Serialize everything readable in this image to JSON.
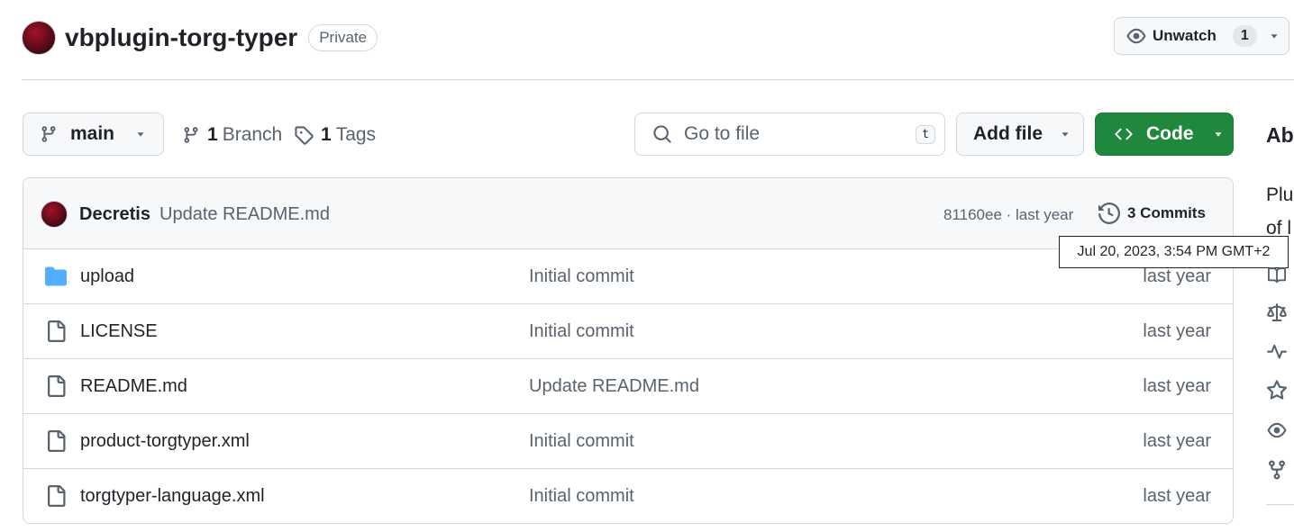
{
  "repo": {
    "name": "vbplugin-torg-typer",
    "visibility": "Private",
    "watch_label": "Unwatch",
    "watch_count": "1"
  },
  "toolbar": {
    "branch": "main",
    "branches_count": "1",
    "branches_label": "Branch",
    "tags_count": "1",
    "tags_label": "Tags",
    "go_to_file_placeholder": "Go to file",
    "go_to_file_shortcut": "t",
    "add_file_label": "Add file",
    "code_label": "Code"
  },
  "latest_commit": {
    "author": "Decretis",
    "message": "Update README.md",
    "hash_and_time": "81160ee · last year",
    "commits_label": "3 Commits"
  },
  "tooltip": "Jul 20, 2023, 3:54 PM GMT+2",
  "files": [
    {
      "type": "folder",
      "name": "upload",
      "commit": "Initial commit",
      "date": "last year"
    },
    {
      "type": "file",
      "name": "LICENSE",
      "commit": "Initial commit",
      "date": "last year"
    },
    {
      "type": "file",
      "name": "README.md",
      "commit": "Update README.md",
      "date": "last year"
    },
    {
      "type": "file",
      "name": "product-torgtyper.xml",
      "commit": "Initial commit",
      "date": "last year"
    },
    {
      "type": "file",
      "name": "torgtyper-language.xml",
      "commit": "Initial commit",
      "date": "last year"
    }
  ],
  "about": {
    "title": "Ab",
    "description_line1": "Plu",
    "description_line2": "of l",
    "icons": [
      "book-icon",
      "law-icon",
      "pulse-icon",
      "star-icon",
      "eye-icon",
      "fork-icon"
    ]
  },
  "colors": {
    "code_button": "#1f883d",
    "folder_icon": "#54aeff",
    "muted_text": "#59636e"
  }
}
